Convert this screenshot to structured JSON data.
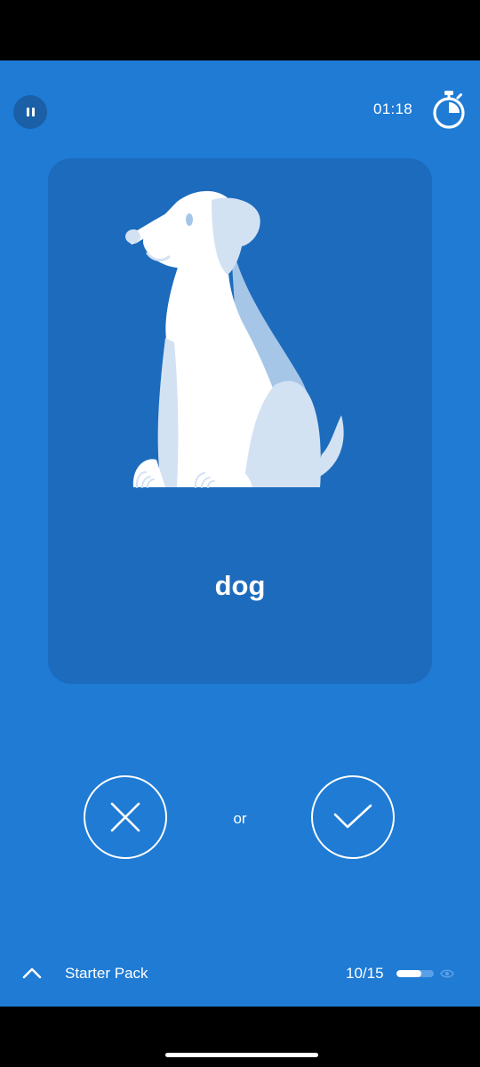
{
  "timer": {
    "value": "01:18",
    "icon": "stopwatch-icon"
  },
  "card": {
    "word": "dog",
    "illustration": "dog-illustration"
  },
  "actions": {
    "or_label": "or",
    "reject_icon": "close-icon",
    "accept_icon": "check-icon"
  },
  "footer": {
    "pack_name": "Starter Pack",
    "progress_text": "10/15",
    "progress_fraction": 0.67,
    "expand_icon": "chevron-up-icon",
    "eye_icon": "eye-icon"
  },
  "colors": {
    "background": "#1F7BD4",
    "card": "#1D6BBD",
    "pause_button": "#1B5FA6"
  }
}
